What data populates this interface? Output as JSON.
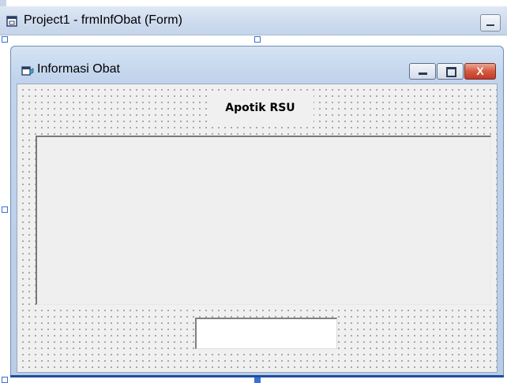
{
  "designer": {
    "title": "Project1 - frmInfObat (Form)",
    "icon": "form-designer-icon"
  },
  "form": {
    "title": "Informasi Obat",
    "icon": "vb-form-icon",
    "close_glyph": "X"
  },
  "content": {
    "header_label": "Apotik RSU",
    "list_items": [],
    "textbox_value": ""
  },
  "colors": {
    "titlebar": "#c8d6ea",
    "close_button": "#d65a3f",
    "client_bg": "#f0f0f0",
    "selection_handle": "#3a6fd8"
  }
}
